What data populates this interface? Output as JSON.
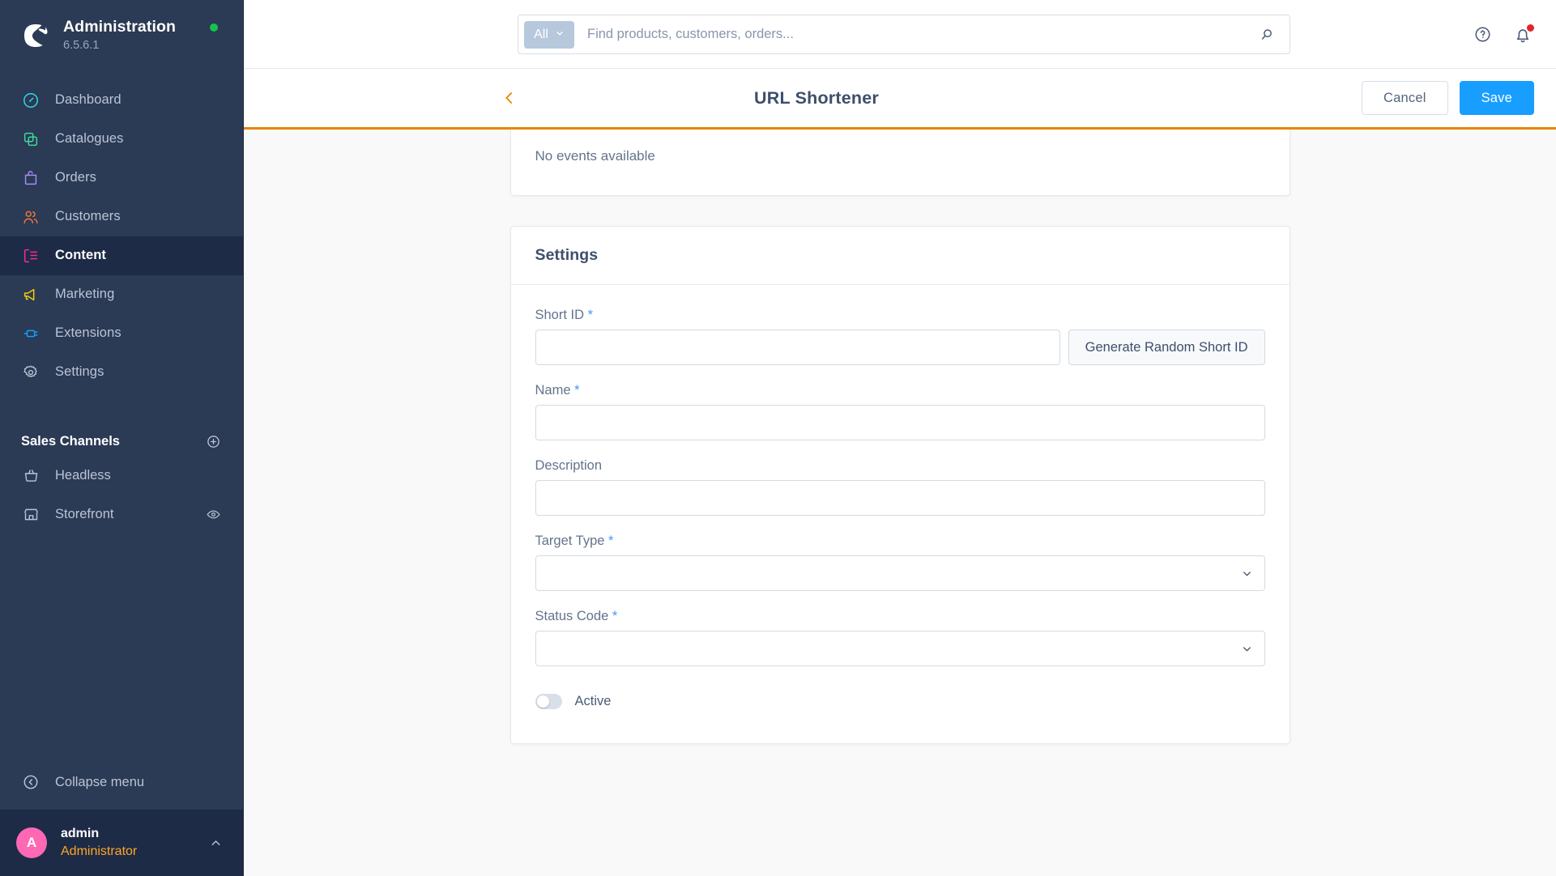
{
  "sidebar": {
    "app_title": "Administration",
    "version": "6.5.6.1",
    "status_indicator_color": "#16c34a",
    "nav_items": [
      {
        "label": "Dashboard",
        "icon": "dashboard-icon",
        "color": "#37d7e5",
        "active": false
      },
      {
        "label": "Catalogues",
        "icon": "catalogues-icon",
        "color": "#3ed99a",
        "active": false
      },
      {
        "label": "Orders",
        "icon": "orders-icon",
        "color": "#a78bfa",
        "active": false
      },
      {
        "label": "Customers",
        "icon": "customers-icon",
        "color": "#f2743c",
        "active": false
      },
      {
        "label": "Content",
        "icon": "content-icon",
        "color": "#f72ba0",
        "active": true
      },
      {
        "label": "Marketing",
        "icon": "marketing-icon",
        "color": "#f5d000",
        "active": false
      },
      {
        "label": "Extensions",
        "icon": "extensions-icon",
        "color": "#189eff",
        "active": false
      },
      {
        "label": "Settings",
        "icon": "settings-gear-icon",
        "color": "#bac4d5",
        "active": false
      }
    ],
    "sales_channels": {
      "title": "Sales Channels",
      "add_icon": "plus-circle-icon",
      "items": [
        {
          "label": "Headless",
          "icon": "basket-icon",
          "trailing_icon": ""
        },
        {
          "label": "Storefront",
          "icon": "storefront-icon",
          "trailing_icon": "eye-icon"
        }
      ]
    },
    "collapse": {
      "label": "Collapse menu",
      "icon": "collapse-left-circle-icon"
    },
    "user": {
      "avatar_initial": "A",
      "avatar_color": "#ff68b4",
      "name": "admin",
      "role": "Administrator",
      "caret_icon": "chevron-up-icon"
    }
  },
  "topbar": {
    "search": {
      "scope_label": "All",
      "scope_caret_icon": "chevron-down-icon",
      "placeholder": "Find products, customers, orders...",
      "value": "",
      "search_icon": "search-icon"
    },
    "help_icon": "help-circle-icon",
    "notifications_icon": "bell-icon",
    "notification_badge_color": "#e52427"
  },
  "pageheader": {
    "back_icon": "chevron-left-icon",
    "back_icon_color": "#e98300",
    "title": "URL Shortener",
    "cancel_label": "Cancel",
    "save_label": "Save",
    "save_color": "#189eff",
    "progress_bar_color": "#e98300"
  },
  "content": {
    "events_card": {
      "empty_text": "No events available"
    },
    "settings_card": {
      "title": "Settings",
      "fields": [
        {
          "key": "short_id",
          "label": "Short ID",
          "required": true,
          "type": "text-with-button",
          "value": "",
          "placeholder": "",
          "button_label": "Generate Random Short ID"
        },
        {
          "key": "name",
          "label": "Name",
          "required": true,
          "type": "text",
          "value": "",
          "placeholder": ""
        },
        {
          "key": "description",
          "label": "Description",
          "required": false,
          "type": "text",
          "value": "",
          "placeholder": ""
        },
        {
          "key": "target_type",
          "label": "Target Type",
          "required": true,
          "type": "select",
          "value": "",
          "caret_icon": "chevron-down-icon"
        },
        {
          "key": "status_code",
          "label": "Status Code",
          "required": true,
          "type": "select",
          "value": "",
          "caret_icon": "chevron-down-icon"
        }
      ],
      "toggle": {
        "label": "Active",
        "checked": false
      }
    }
  }
}
